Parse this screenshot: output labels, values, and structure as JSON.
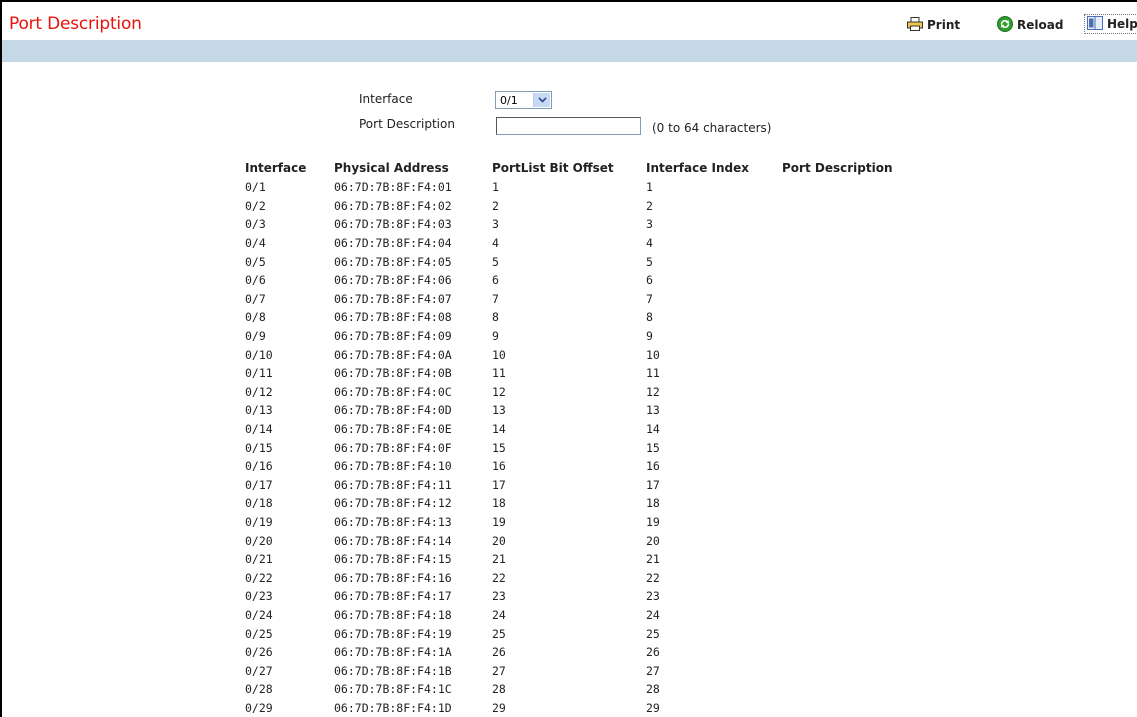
{
  "header": {
    "title": "Port Description",
    "print_label": "Print",
    "reload_label": "Reload",
    "help_label": "Help"
  },
  "form": {
    "interface_label": "Interface",
    "interface_value": "0/1",
    "port_description_label": "Port Description",
    "port_description_value": "",
    "hint": "(0 to 64 characters)"
  },
  "table": {
    "columns": [
      "Interface",
      "Physical Address",
      "PortList Bit Offset",
      "Interface Index",
      "Port Description"
    ],
    "rows": [
      [
        "0/1",
        "06:7D:7B:8F:F4:01",
        "1",
        "1",
        ""
      ],
      [
        "0/2",
        "06:7D:7B:8F:F4:02",
        "2",
        "2",
        ""
      ],
      [
        "0/3",
        "06:7D:7B:8F:F4:03",
        "3",
        "3",
        ""
      ],
      [
        "0/4",
        "06:7D:7B:8F:F4:04",
        "4",
        "4",
        ""
      ],
      [
        "0/5",
        "06:7D:7B:8F:F4:05",
        "5",
        "5",
        ""
      ],
      [
        "0/6",
        "06:7D:7B:8F:F4:06",
        "6",
        "6",
        ""
      ],
      [
        "0/7",
        "06:7D:7B:8F:F4:07",
        "7",
        "7",
        ""
      ],
      [
        "0/8",
        "06:7D:7B:8F:F4:08",
        "8",
        "8",
        ""
      ],
      [
        "0/9",
        "06:7D:7B:8F:F4:09",
        "9",
        "9",
        ""
      ],
      [
        "0/10",
        "06:7D:7B:8F:F4:0A",
        "10",
        "10",
        ""
      ],
      [
        "0/11",
        "06:7D:7B:8F:F4:0B",
        "11",
        "11",
        ""
      ],
      [
        "0/12",
        "06:7D:7B:8F:F4:0C",
        "12",
        "12",
        ""
      ],
      [
        "0/13",
        "06:7D:7B:8F:F4:0D",
        "13",
        "13",
        ""
      ],
      [
        "0/14",
        "06:7D:7B:8F:F4:0E",
        "14",
        "14",
        ""
      ],
      [
        "0/15",
        "06:7D:7B:8F:F4:0F",
        "15",
        "15",
        ""
      ],
      [
        "0/16",
        "06:7D:7B:8F:F4:10",
        "16",
        "16",
        ""
      ],
      [
        "0/17",
        "06:7D:7B:8F:F4:11",
        "17",
        "17",
        ""
      ],
      [
        "0/18",
        "06:7D:7B:8F:F4:12",
        "18",
        "18",
        ""
      ],
      [
        "0/19",
        "06:7D:7B:8F:F4:13",
        "19",
        "19",
        ""
      ],
      [
        "0/20",
        "06:7D:7B:8F:F4:14",
        "20",
        "20",
        ""
      ],
      [
        "0/21",
        "06:7D:7B:8F:F4:15",
        "21",
        "21",
        ""
      ],
      [
        "0/22",
        "06:7D:7B:8F:F4:16",
        "22",
        "22",
        ""
      ],
      [
        "0/23",
        "06:7D:7B:8F:F4:17",
        "23",
        "23",
        ""
      ],
      [
        "0/24",
        "06:7D:7B:8F:F4:18",
        "24",
        "24",
        ""
      ],
      [
        "0/25",
        "06:7D:7B:8F:F4:19",
        "25",
        "25",
        ""
      ],
      [
        "0/26",
        "06:7D:7B:8F:F4:1A",
        "26",
        "26",
        ""
      ],
      [
        "0/27",
        "06:7D:7B:8F:F4:1B",
        "27",
        "27",
        ""
      ],
      [
        "0/28",
        "06:7D:7B:8F:F4:1C",
        "28",
        "28",
        ""
      ],
      [
        "0/29",
        "06:7D:7B:8F:F4:1D",
        "29",
        "29",
        ""
      ]
    ]
  },
  "colors": {
    "title": "#e8120c",
    "band": "#c4d8e6",
    "reload_icon": "#2e9e2e"
  },
  "icons": {
    "print": "printer-icon",
    "reload": "reload-icon",
    "help": "help-book-icon",
    "dropdown": "chevron-down-icon"
  }
}
